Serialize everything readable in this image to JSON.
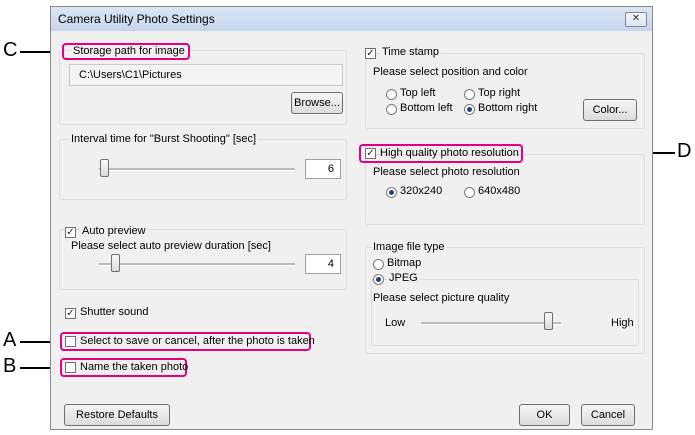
{
  "window": {
    "title": "Camera Utility Photo Settings",
    "close_glyph": "✕"
  },
  "storage": {
    "label": "Storage path for image",
    "path": "C:\\Users\\C1\\Pictures",
    "browse_label": "Browse..."
  },
  "interval": {
    "label": "Interval time for \"Burst Shooting\" [sec]",
    "value": "6",
    "level": 0.0
  },
  "auto_preview": {
    "label": "Auto preview",
    "checked": true,
    "duration_label": "Please select auto preview duration [sec]",
    "value": "4",
    "level": 0.05
  },
  "shutter_sound": {
    "label": "Shutter sound",
    "checked": true
  },
  "select_to_save": {
    "label": "Select to save or cancel, after the photo is taken",
    "checked": false
  },
  "name_photo": {
    "label": "Name the taken photo",
    "checked": false
  },
  "time_stamp": {
    "label": "Time stamp",
    "checked": true,
    "position_label": "Please select position and color",
    "options": [
      "Top left",
      "Top right",
      "Bottom left",
      "Bottom right"
    ],
    "selected": "Bottom right",
    "color_button": "Color..."
  },
  "high_quality": {
    "label": "High quality photo resolution",
    "checked": true,
    "resolution_label": "Please select photo resolution",
    "options": [
      "320x240",
      "640x480"
    ],
    "selected": "320x240"
  },
  "file_type": {
    "label": "Image file type",
    "options": [
      "Bitmap",
      "JPEG"
    ],
    "selected": "JPEG",
    "quality_label": "Please select picture quality",
    "low_label": "Low",
    "high_label": "High",
    "quality_level": 0.9
  },
  "buttons": {
    "restore": "Restore Defaults",
    "ok": "OK",
    "cancel": "Cancel"
  },
  "callouts": {
    "a": "A",
    "b": "B",
    "c": "C",
    "d": "D"
  },
  "colors": {
    "highlight": "#e4007f",
    "titlebar": "#c9d9ee",
    "dialog_bg": "#f0f0f0"
  },
  "check_glyph": "✓"
}
